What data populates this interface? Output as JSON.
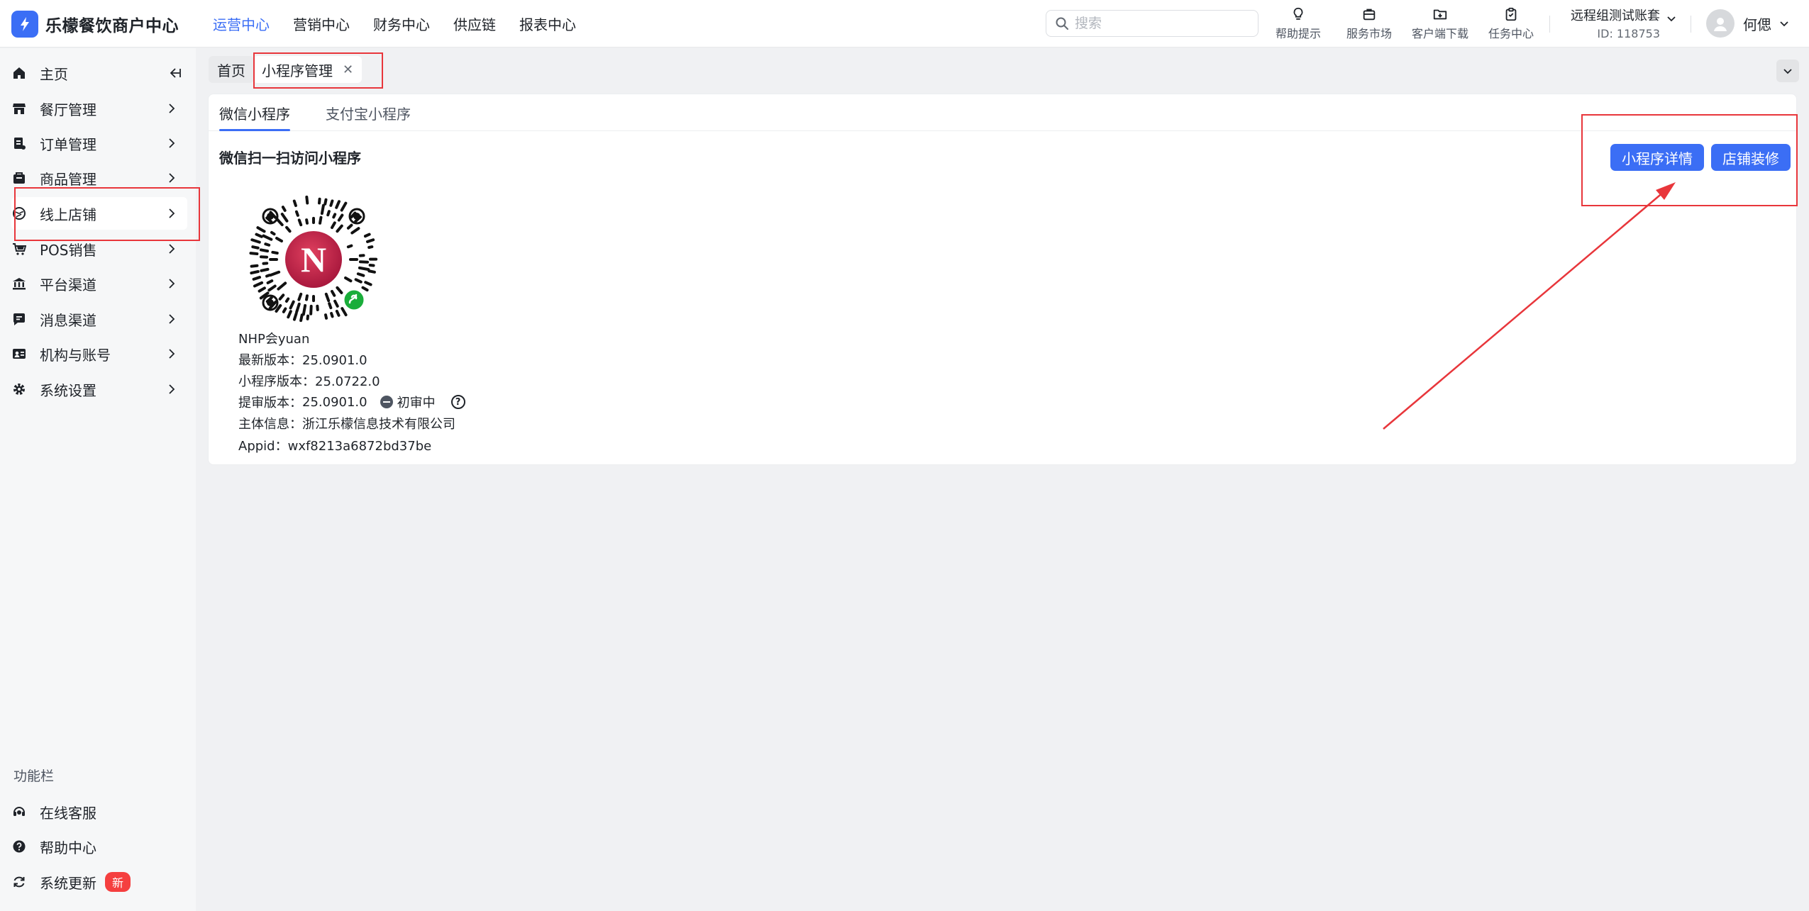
{
  "header": {
    "app_name": "乐檬餐饮商户中心",
    "nav": [
      "运营中心",
      "营销中心",
      "财务中心",
      "供应链",
      "报表中心"
    ],
    "active_nav": 0,
    "search_placeholder": "搜索",
    "tools": [
      {
        "label": "帮助提示",
        "icon": "lightbulb-icon"
      },
      {
        "label": "服务市场",
        "icon": "shopping-bag-icon"
      },
      {
        "label": "客户端下载",
        "icon": "folder-download-icon"
      },
      {
        "label": "任务中心",
        "icon": "clipboard-icon"
      }
    ],
    "account_name": "远程组测试账套",
    "account_id": "ID: 118753",
    "user_name": "何偲"
  },
  "sidebar": {
    "items": [
      {
        "label": "主页",
        "icon": "home-icon"
      },
      {
        "label": "餐厅管理",
        "icon": "store-icon"
      },
      {
        "label": "订单管理",
        "icon": "order-icon"
      },
      {
        "label": "商品管理",
        "icon": "goods-icon"
      },
      {
        "label": "线上店铺",
        "icon": "online-store-icon"
      },
      {
        "label": "POS销售",
        "icon": "cart-icon"
      },
      {
        "label": "平台渠道",
        "icon": "bank-icon"
      },
      {
        "label": "消息渠道",
        "icon": "message-icon"
      },
      {
        "label": "机构与账号",
        "icon": "id-card-icon"
      },
      {
        "label": "系统设置",
        "icon": "gear-icon"
      }
    ],
    "function_title": "功能栏",
    "function_items": [
      {
        "label": "在线客服",
        "icon": "headset-icon"
      },
      {
        "label": "帮助中心",
        "icon": "question-icon"
      },
      {
        "label": "系统更新",
        "icon": "refresh-icon",
        "badge": "新"
      }
    ]
  },
  "page_tabs": {
    "home": "首页",
    "current": "小程序管理"
  },
  "content": {
    "tabs": [
      "微信小程序",
      "支付宝小程序"
    ],
    "section_title": "微信扫一扫访问小程序",
    "buttons": {
      "detail": "小程序详情",
      "decorate": "店铺装修"
    },
    "qr_logo_letter": "N",
    "mini_program_name": "NHP会yuan",
    "latest_version_label": "最新版本：",
    "latest_version": "25.0901.0",
    "mp_version_label": "小程序版本：",
    "mp_version": "25.0722.0",
    "audit_version_label": "提审版本：",
    "audit_version": "25.0901.0",
    "audit_status": "初审中",
    "entity_label": "主体信息：",
    "entity": "浙江乐檬信息技术有限公司",
    "appid_label": "Appid：",
    "appid": "wxf8213a6872bd37be"
  },
  "colors": {
    "primary": "#3b6ef5",
    "annotation": "#e8363b",
    "badge": "#f53f3f"
  }
}
